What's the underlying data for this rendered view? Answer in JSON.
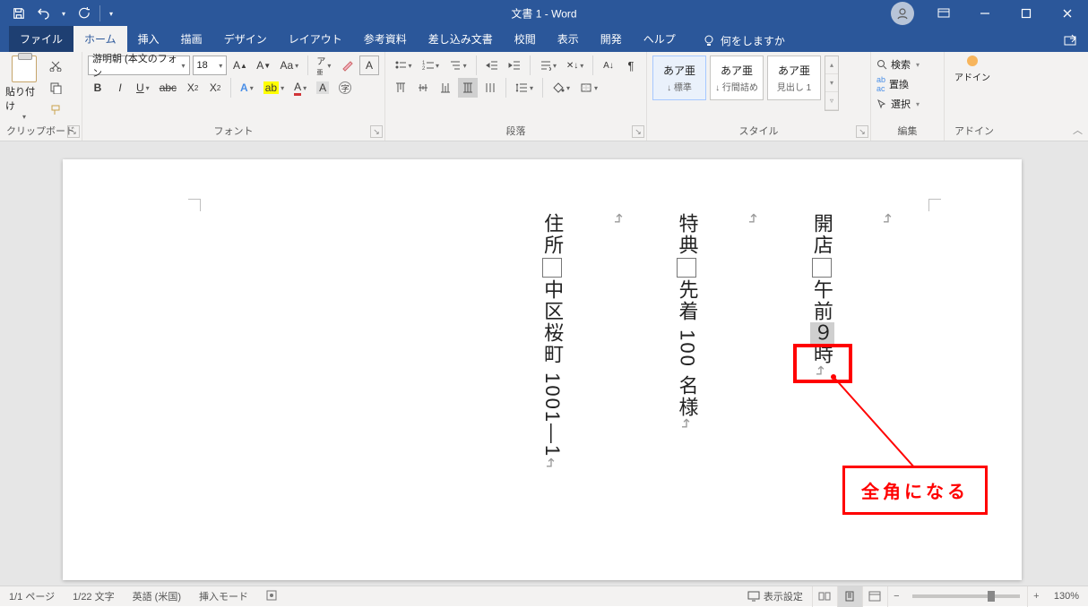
{
  "title": "文書 1  -  Word",
  "tabs": {
    "file": "ファイル",
    "home": "ホーム",
    "insert": "挿入",
    "draw": "描画",
    "design": "デザイン",
    "layout": "レイアウト",
    "references": "参考資料",
    "mailings": "差し込み文書",
    "review": "校閲",
    "view": "表示",
    "developer": "開発",
    "help": "ヘルプ",
    "tellme": "何をしますか"
  },
  "ribbon": {
    "clipboard": {
      "label": "クリップボード",
      "paste": "貼り付け"
    },
    "font": {
      "label": "フォント",
      "name": "游明朝 (本文のフォン",
      "size": "18"
    },
    "paragraph": {
      "label": "段落"
    },
    "styles": {
      "label": "スタイル",
      "items": [
        {
          "sample": "あア亜",
          "name": "↓ 標準"
        },
        {
          "sample": "あア亜",
          "name": "↓ 行間詰め"
        },
        {
          "sample": "あア亜",
          "name": "見出し 1"
        }
      ]
    },
    "editing": {
      "label": "編集",
      "find": "検索",
      "replace": "置換",
      "select": "選択"
    },
    "addin": {
      "label": "アドイン",
      "btn": "アドイン"
    }
  },
  "doc": {
    "col1": {
      "a": "開店",
      "b": "午前",
      "c": "９",
      "d": "時"
    },
    "col2": {
      "a": "特典",
      "b": "先着 100 名様"
    },
    "col3": {
      "a": "住所",
      "b": "中区桜町 1001―1"
    }
  },
  "annotation": {
    "callout": "全角になる"
  },
  "status": {
    "page": "1/1 ページ",
    "words": "1/22 文字",
    "lang": "英語 (米国)",
    "mode": "挿入モード",
    "display": "表示設定",
    "zoom": "130%"
  }
}
